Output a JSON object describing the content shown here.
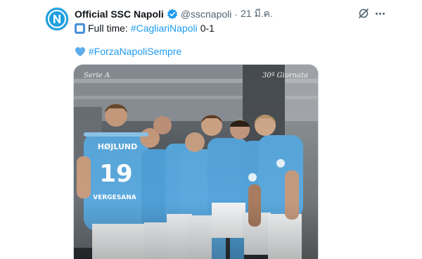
{
  "tweet": {
    "display_name": "Official SSC Napoli",
    "handle": "@sscnapoli",
    "separator": "·",
    "date": "21 มี.ค.",
    "line1": {
      "prefix": "Full time: ",
      "hashtag": "#CagliariNapoli",
      "score": " 0-1"
    },
    "line2": {
      "hashtag": "#ForzaNapoliSempre"
    }
  },
  "media": {
    "top_left": "Serie A",
    "top_right": "30ª Giornata",
    "jersey_name": "HØJLUND",
    "jersey_number": "19",
    "sponsor": "VERGESANA"
  },
  "icons": {
    "avatar": "napoli-logo-icon",
    "verified": "verified-badge-icon",
    "grok": "grok-icon",
    "more": "more-options-icon"
  },
  "colors": {
    "accent": "#1d9bf0",
    "avatar_bg": "#1da0e0",
    "jersey": "#5aa8dd"
  }
}
